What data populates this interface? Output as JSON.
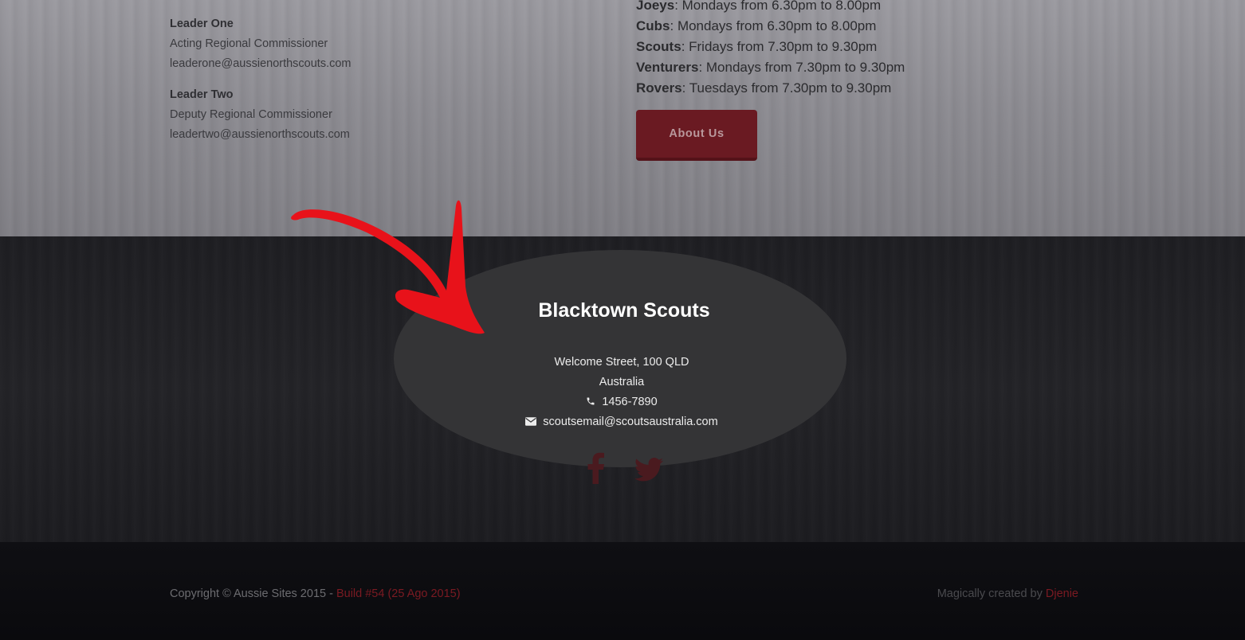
{
  "leaders": [
    {
      "name": "Leader One",
      "role": "Acting Regional Commissioner",
      "email": "leaderone@aussienorthscouts.com"
    },
    {
      "name": "Leader Two",
      "role": "Deputy Regional Commissioner",
      "email": "leadertwo@aussienorthscouts.com"
    }
  ],
  "meetings": [
    {
      "group": "Joeys",
      "time": ": Mondays from 6.30pm to 8.00pm"
    },
    {
      "group": "Cubs",
      "time": ": Mondays from 6.30pm to 8.00pm"
    },
    {
      "group": "Scouts",
      "time": ": Fridays from 7.30pm to 9.30pm"
    },
    {
      "group": "Venturers",
      "time": ": Mondays from 7.30pm to 9.30pm"
    },
    {
      "group": "Rovers",
      "time": ": Tuesdays from 7.30pm to 9.30pm"
    }
  ],
  "about_button": "About Us",
  "footer": {
    "title": "Blacktown Scouts",
    "address_line1": "Welcome Street, 100 QLD",
    "address_line2": "Australia",
    "phone": "1456-7890",
    "email": "scoutsemail@scoutsaustralia.com",
    "phone_icon": "phone-icon",
    "email_icon": "envelope-icon",
    "social": [
      "facebook-icon",
      "twitter-icon"
    ]
  },
  "bottom": {
    "copyright": "Copyright © Aussie Sites 2015 - ",
    "build_link": "Build #54 (25 Ago 2015)",
    "credit_text": "Magically created by ",
    "credit_link": "Djenie"
  },
  "colors": {
    "accent": "#7b1a22",
    "arrow": "#e8121a"
  }
}
